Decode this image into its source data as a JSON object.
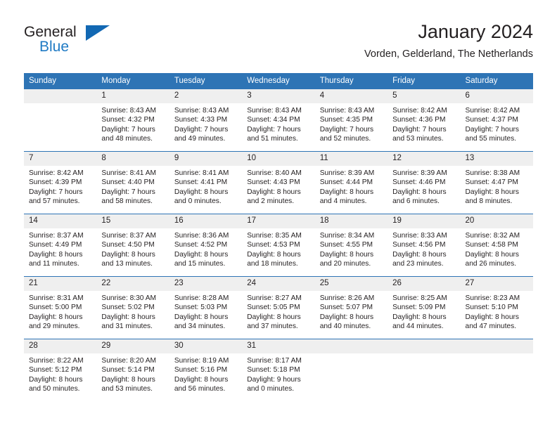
{
  "logo": {
    "word_general": "General",
    "word_blue": "Blue",
    "triangle_color": "#1268b3",
    "blue_color": "#1f7ac4"
  },
  "header": {
    "title": "January 2024",
    "subtitle": "Vorden, Gelderland, The Netherlands"
  },
  "theme": {
    "header_row_bg": "#2e74b5",
    "daynum_bg": "#efefef",
    "row_divider": "#2e74b5",
    "text": "#231f20"
  },
  "calendar": {
    "weekday_headers": [
      "Sunday",
      "Monday",
      "Tuesday",
      "Wednesday",
      "Thursday",
      "Friday",
      "Saturday"
    ],
    "weeks": [
      [
        {
          "day": "",
          "lines": []
        },
        {
          "day": "1",
          "lines": [
            "Sunrise: 8:43 AM",
            "Sunset: 4:32 PM",
            "Daylight: 7 hours",
            "and 48 minutes."
          ]
        },
        {
          "day": "2",
          "lines": [
            "Sunrise: 8:43 AM",
            "Sunset: 4:33 PM",
            "Daylight: 7 hours",
            "and 49 minutes."
          ]
        },
        {
          "day": "3",
          "lines": [
            "Sunrise: 8:43 AM",
            "Sunset: 4:34 PM",
            "Daylight: 7 hours",
            "and 51 minutes."
          ]
        },
        {
          "day": "4",
          "lines": [
            "Sunrise: 8:43 AM",
            "Sunset: 4:35 PM",
            "Daylight: 7 hours",
            "and 52 minutes."
          ]
        },
        {
          "day": "5",
          "lines": [
            "Sunrise: 8:42 AM",
            "Sunset: 4:36 PM",
            "Daylight: 7 hours",
            "and 53 minutes."
          ]
        },
        {
          "day": "6",
          "lines": [
            "Sunrise: 8:42 AM",
            "Sunset: 4:37 PM",
            "Daylight: 7 hours",
            "and 55 minutes."
          ]
        }
      ],
      [
        {
          "day": "7",
          "lines": [
            "Sunrise: 8:42 AM",
            "Sunset: 4:39 PM",
            "Daylight: 7 hours",
            "and 57 minutes."
          ]
        },
        {
          "day": "8",
          "lines": [
            "Sunrise: 8:41 AM",
            "Sunset: 4:40 PM",
            "Daylight: 7 hours",
            "and 58 minutes."
          ]
        },
        {
          "day": "9",
          "lines": [
            "Sunrise: 8:41 AM",
            "Sunset: 4:41 PM",
            "Daylight: 8 hours",
            "and 0 minutes."
          ]
        },
        {
          "day": "10",
          "lines": [
            "Sunrise: 8:40 AM",
            "Sunset: 4:43 PM",
            "Daylight: 8 hours",
            "and 2 minutes."
          ]
        },
        {
          "day": "11",
          "lines": [
            "Sunrise: 8:39 AM",
            "Sunset: 4:44 PM",
            "Daylight: 8 hours",
            "and 4 minutes."
          ]
        },
        {
          "day": "12",
          "lines": [
            "Sunrise: 8:39 AM",
            "Sunset: 4:46 PM",
            "Daylight: 8 hours",
            "and 6 minutes."
          ]
        },
        {
          "day": "13",
          "lines": [
            "Sunrise: 8:38 AM",
            "Sunset: 4:47 PM",
            "Daylight: 8 hours",
            "and 8 minutes."
          ]
        }
      ],
      [
        {
          "day": "14",
          "lines": [
            "Sunrise: 8:37 AM",
            "Sunset: 4:49 PM",
            "Daylight: 8 hours",
            "and 11 minutes."
          ]
        },
        {
          "day": "15",
          "lines": [
            "Sunrise: 8:37 AM",
            "Sunset: 4:50 PM",
            "Daylight: 8 hours",
            "and 13 minutes."
          ]
        },
        {
          "day": "16",
          "lines": [
            "Sunrise: 8:36 AM",
            "Sunset: 4:52 PM",
            "Daylight: 8 hours",
            "and 15 minutes."
          ]
        },
        {
          "day": "17",
          "lines": [
            "Sunrise: 8:35 AM",
            "Sunset: 4:53 PM",
            "Daylight: 8 hours",
            "and 18 minutes."
          ]
        },
        {
          "day": "18",
          "lines": [
            "Sunrise: 8:34 AM",
            "Sunset: 4:55 PM",
            "Daylight: 8 hours",
            "and 20 minutes."
          ]
        },
        {
          "day": "19",
          "lines": [
            "Sunrise: 8:33 AM",
            "Sunset: 4:56 PM",
            "Daylight: 8 hours",
            "and 23 minutes."
          ]
        },
        {
          "day": "20",
          "lines": [
            "Sunrise: 8:32 AM",
            "Sunset: 4:58 PM",
            "Daylight: 8 hours",
            "and 26 minutes."
          ]
        }
      ],
      [
        {
          "day": "21",
          "lines": [
            "Sunrise: 8:31 AM",
            "Sunset: 5:00 PM",
            "Daylight: 8 hours",
            "and 29 minutes."
          ]
        },
        {
          "day": "22",
          "lines": [
            "Sunrise: 8:30 AM",
            "Sunset: 5:02 PM",
            "Daylight: 8 hours",
            "and 31 minutes."
          ]
        },
        {
          "day": "23",
          "lines": [
            "Sunrise: 8:28 AM",
            "Sunset: 5:03 PM",
            "Daylight: 8 hours",
            "and 34 minutes."
          ]
        },
        {
          "day": "24",
          "lines": [
            "Sunrise: 8:27 AM",
            "Sunset: 5:05 PM",
            "Daylight: 8 hours",
            "and 37 minutes."
          ]
        },
        {
          "day": "25",
          "lines": [
            "Sunrise: 8:26 AM",
            "Sunset: 5:07 PM",
            "Daylight: 8 hours",
            "and 40 minutes."
          ]
        },
        {
          "day": "26",
          "lines": [
            "Sunrise: 8:25 AM",
            "Sunset: 5:09 PM",
            "Daylight: 8 hours",
            "and 44 minutes."
          ]
        },
        {
          "day": "27",
          "lines": [
            "Sunrise: 8:23 AM",
            "Sunset: 5:10 PM",
            "Daylight: 8 hours",
            "and 47 minutes."
          ]
        }
      ],
      [
        {
          "day": "28",
          "lines": [
            "Sunrise: 8:22 AM",
            "Sunset: 5:12 PM",
            "Daylight: 8 hours",
            "and 50 minutes."
          ]
        },
        {
          "day": "29",
          "lines": [
            "Sunrise: 8:20 AM",
            "Sunset: 5:14 PM",
            "Daylight: 8 hours",
            "and 53 minutes."
          ]
        },
        {
          "day": "30",
          "lines": [
            "Sunrise: 8:19 AM",
            "Sunset: 5:16 PM",
            "Daylight: 8 hours",
            "and 56 minutes."
          ]
        },
        {
          "day": "31",
          "lines": [
            "Sunrise: 8:17 AM",
            "Sunset: 5:18 PM",
            "Daylight: 9 hours",
            "and 0 minutes."
          ]
        },
        {
          "day": "",
          "lines": []
        },
        {
          "day": "",
          "lines": []
        },
        {
          "day": "",
          "lines": []
        }
      ]
    ]
  }
}
